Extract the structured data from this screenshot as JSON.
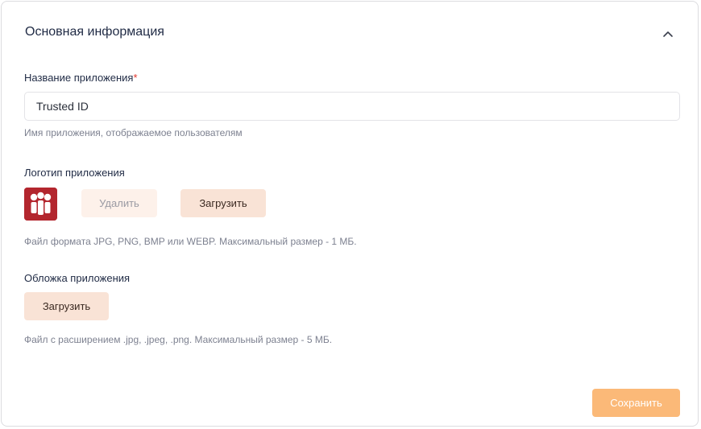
{
  "section": {
    "title": "Основная информация",
    "collapse_icon": "chevron-up-icon"
  },
  "app_name": {
    "label": "Название приложения",
    "required_mark": "*",
    "value": "Trusted ID",
    "hint": "Имя приложения, отображаемое пользователям"
  },
  "logo": {
    "label": "Логотип приложения",
    "icon": "app-logo-icon",
    "delete_label": "Удалить",
    "upload_label": "Загрузить",
    "hint": "Файл формата JPG, PNG, BMP или WEBP. Максимальный размер - 1 МБ."
  },
  "cover": {
    "label": "Обложка приложения",
    "upload_label": "Загрузить",
    "hint": "Файл с расширением .jpg, .jpeg, .png. Максимальный размер - 5 МБ."
  },
  "footer": {
    "save_label": "Сохранить"
  },
  "colors": {
    "accent": "#fbb978",
    "upload_bg": "#f9e3d6",
    "logo_bg": "#b3262e",
    "required": "#e0352b"
  }
}
